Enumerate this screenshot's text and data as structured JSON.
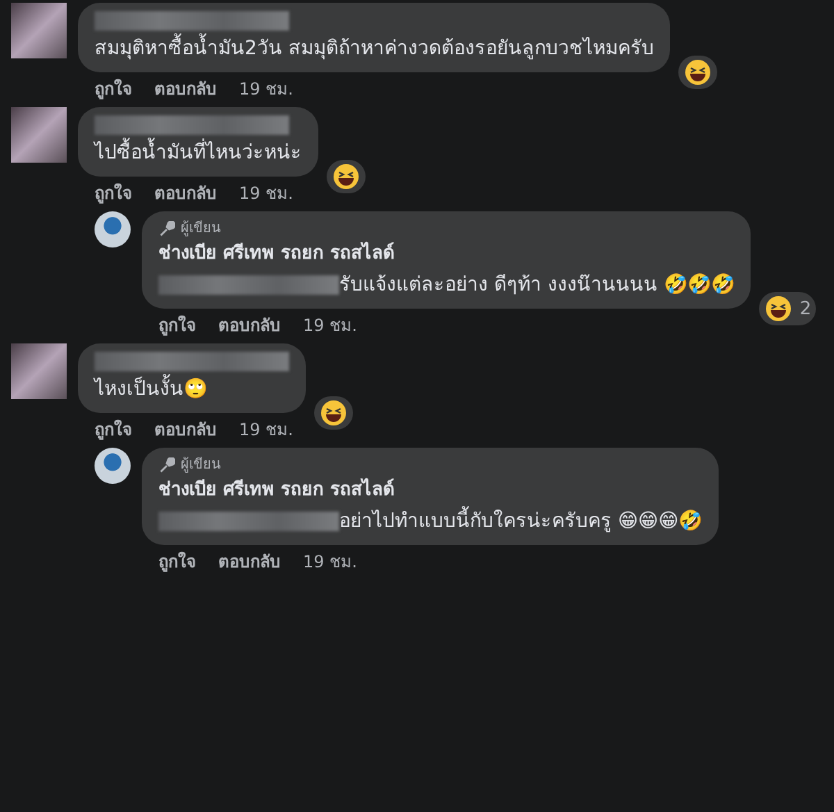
{
  "comments": [
    {
      "author_redacted": true,
      "text": "สมมุติหาซื้อน้ำมัน2วัน สมมุติถ้าหาค่างวดต้องรอยันลูกบวชไหมครับ",
      "reaction": {
        "kind": "haha"
      },
      "actions": [
        "ถูกใจ",
        "ตอบกลับ",
        "19 ชม."
      ]
    },
    {
      "author_redacted": true,
      "text": "ไปซื้อน้ำมันที่ไหนว่ะหน่ะ",
      "reaction": {
        "kind": "haha"
      },
      "actions": [
        "ถูกใจ",
        "ตอบกลับ",
        "19 ชม."
      ],
      "replies": [
        {
          "badge": "ผู้เขียน",
          "author": "ช่างเบีย ศรีเทพ รถยก รถสไลด์",
          "mention_redacted": true,
          "text": "รับแจ้งแต่ละอย่าง ดีๆท้า งงงน๊านนนน 🤣🤣🤣",
          "reaction": {
            "kind": "haha",
            "count": "2"
          },
          "actions": [
            "ถูกใจ",
            "ตอบกลับ",
            "19 ชม."
          ]
        }
      ]
    },
    {
      "author_redacted": true,
      "text": "ไหงเป็นงั้น🙄",
      "reaction": {
        "kind": "haha"
      },
      "actions": [
        "ถูกใจ",
        "ตอบกลับ",
        "19 ชม."
      ],
      "replies": [
        {
          "badge": "ผู้เขียน",
          "author": "ช่างเบีย ศรีเทพ รถยก รถสไลด์",
          "mention_redacted": true,
          "text": "อย่าไปทำแบบนี้กับใครน่ะครับครู 😁😁😁🤣",
          "actions": [
            "ถูกใจ",
            "ตอบกลับ",
            "19 ชม."
          ]
        }
      ]
    }
  ]
}
